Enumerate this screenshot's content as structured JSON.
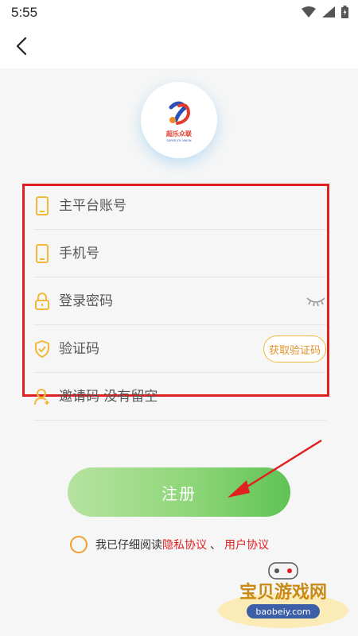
{
  "status": {
    "time": "5:55"
  },
  "form": {
    "account_placeholder": "主平台账号",
    "phone_placeholder": "手机号",
    "password_placeholder": "登录密码",
    "code_placeholder": "验证码",
    "get_code_label": "获取验证码",
    "invite_placeholder": "邀请码 没有留空"
  },
  "register_label": "注册",
  "agreement": {
    "prefix": "我已仔细阅读",
    "privacy": "隐私协议",
    "sep": "、",
    "user": "用户协议"
  },
  "logo": {
    "text": "超乐众联",
    "subtext": "SUPER JOY UNION"
  },
  "watermark": {
    "title": "宝贝游戏网",
    "url": "baobeiy.com"
  },
  "colors": {
    "accent": "#f0b93a",
    "highlight": "#e02020",
    "button_green": "#5fc354"
  }
}
